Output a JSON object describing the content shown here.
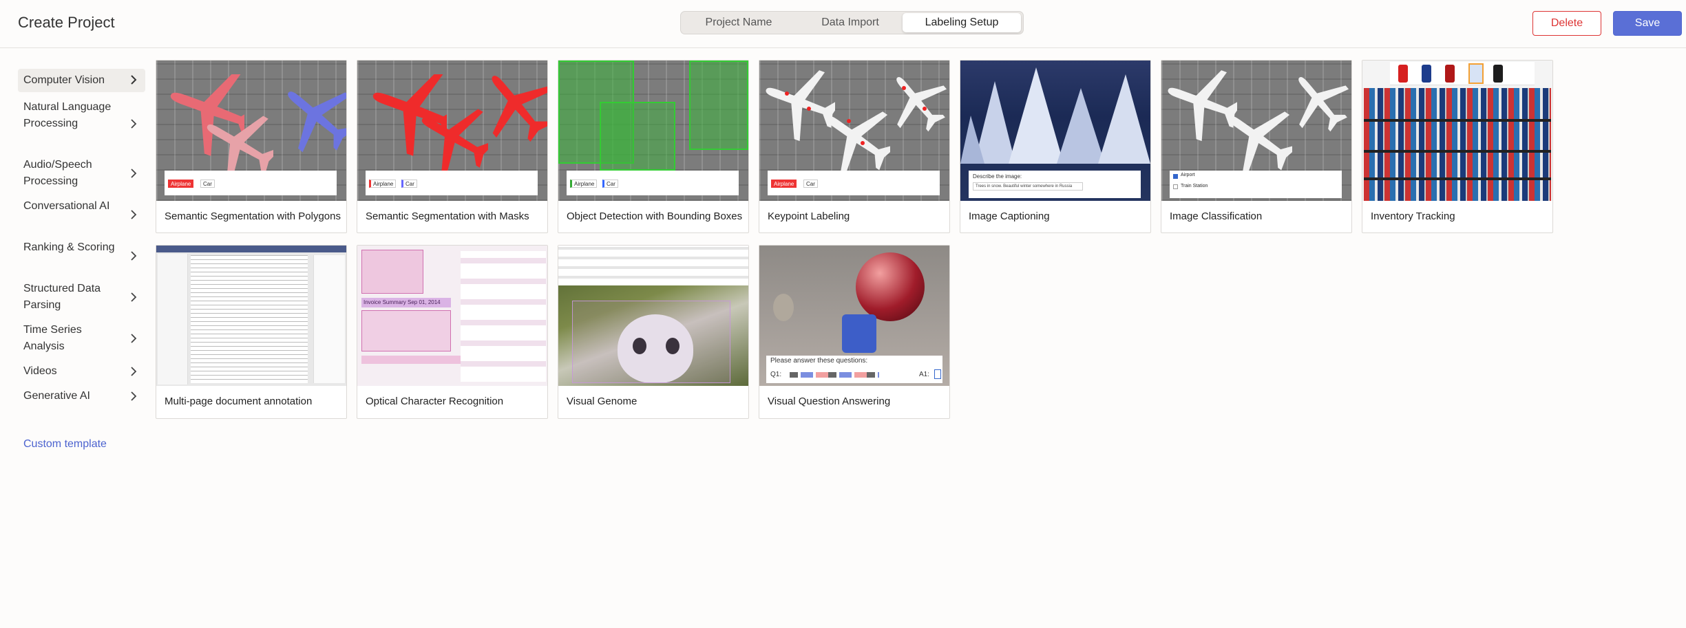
{
  "header": {
    "title": "Create Project",
    "tabs": [
      {
        "label": "Project Name"
      },
      {
        "label": "Data Import"
      },
      {
        "label": "Labeling Setup"
      }
    ],
    "active_tab": "Labeling Setup",
    "delete_label": "Delete",
    "save_label": "Save"
  },
  "sidebar": {
    "items": [
      {
        "label": "Computer Vision"
      },
      {
        "label": "Natural Language Processing"
      },
      {
        "label": "Audio/Speech Processing"
      },
      {
        "label": "Conversational AI"
      },
      {
        "label": "Ranking & Scoring"
      },
      {
        "label": "Structured Data Parsing"
      },
      {
        "label": "Time Series Analysis"
      },
      {
        "label": "Videos"
      },
      {
        "label": "Generative AI"
      }
    ],
    "active": "Computer Vision",
    "custom_template": "Custom template"
  },
  "templates": [
    {
      "label": "Semantic Segmentation with Polygons"
    },
    {
      "label": "Semantic Segmentation with Masks"
    },
    {
      "label": "Object Detection with Bounding Boxes"
    },
    {
      "label": "Keypoint Labeling"
    },
    {
      "label": "Image Captioning"
    },
    {
      "label": "Image Classification"
    },
    {
      "label": "Inventory Tracking"
    },
    {
      "label": "Multi-page document annotation"
    },
    {
      "label": "Optical Character Recognition"
    },
    {
      "label": "Visual Genome"
    },
    {
      "label": "Visual Question Answering"
    }
  ],
  "thumb_text": {
    "airplane": "Airplane",
    "car": "Car",
    "describe": "Describe the image:",
    "caption": "Trees in snow. Beautiful winter somewhere in Russia",
    "airport": "Airport",
    "train_station": "Train Station",
    "invoice": "Invoice Summary Sep 01, 2014",
    "vqa_prompt": "Please answer these questions:",
    "vqa_q": "Q1:",
    "vqa_a": "A1:"
  },
  "colors": {
    "accent": "#5a6fd6",
    "delete": "#d33333",
    "link": "#4c63cf"
  }
}
